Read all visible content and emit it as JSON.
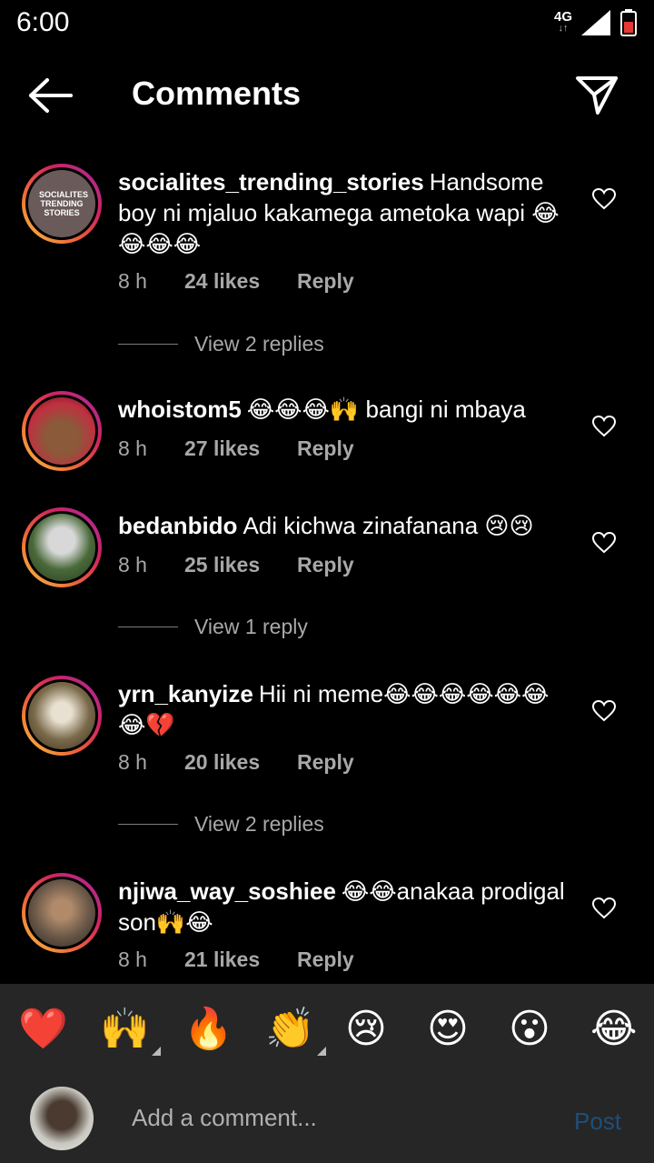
{
  "status_bar": {
    "time": "6:00",
    "network": "4G",
    "network_arrows": "↓↑"
  },
  "header": {
    "title": "Comments"
  },
  "comments": [
    {
      "username": "socialites_trending_stories",
      "text": "Handsome boy ni mjaluo kakamega ametoka wapi 😂😂😂😂",
      "time": "8 h",
      "likes": "24 likes",
      "reply": "Reply",
      "view_replies": "View 2 replies",
      "avatar_label": "SOCIALITES TRENDING STORIES"
    },
    {
      "username": "whoistom5",
      "text": "😂😂😂🙌 bangi ni mbaya",
      "time": "8 h",
      "likes": "27 likes",
      "reply": "Reply"
    },
    {
      "username": "bedanbido",
      "text": "Adi kichwa zinafanana 😢😢",
      "time": "8 h",
      "likes": "25 likes",
      "reply": "Reply",
      "view_replies": "View 1 reply"
    },
    {
      "username": "yrn_kanyize",
      "text": "Hii ni meme😂😂😂😂😂😂😂💔",
      "time": "8 h",
      "likes": "20 likes",
      "reply": "Reply",
      "view_replies": "View 2 replies"
    },
    {
      "username": "njiwa_way_soshiee",
      "text": "😂😂anakaa prodigal son🙌😂",
      "time": "8 h",
      "likes": "21 likes",
      "reply": "Reply"
    }
  ],
  "emoji_bar": [
    "❤️",
    "🙌",
    "🔥",
    "👏",
    "😢",
    "😍",
    "😮",
    "😂"
  ],
  "composer": {
    "placeholder": "Add a comment...",
    "post_label": "Post"
  },
  "colors": {
    "background": "#000000",
    "panel": "#262626",
    "muted_text": "#a8a8a8",
    "post_disabled": "#1f4e79"
  }
}
